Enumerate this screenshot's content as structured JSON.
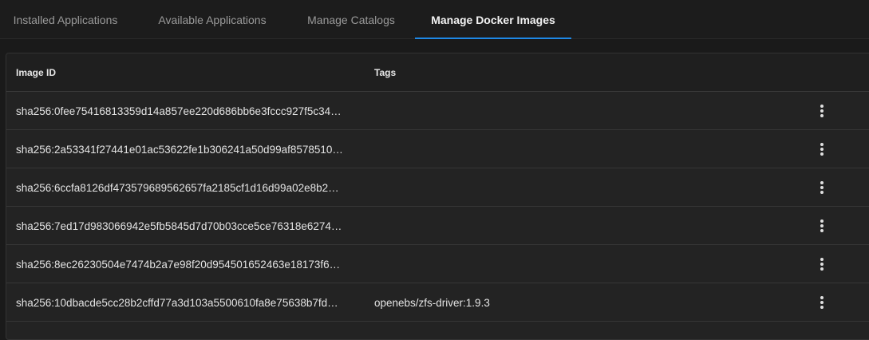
{
  "tabs": [
    {
      "label": "Installed Applications",
      "active": false
    },
    {
      "label": "Available Applications",
      "active": false
    },
    {
      "label": "Manage Catalogs",
      "active": false
    },
    {
      "label": "Manage Docker Images",
      "active": true
    }
  ],
  "accent_color": "#1e88e5",
  "table": {
    "columns": [
      "Image ID",
      "Tags"
    ],
    "rows": [
      {
        "image_id": "sha256:0fee75416813359d14a857ee220d686bb6e3fccc927f5c34…",
        "tags": ""
      },
      {
        "image_id": "sha256:2a53341f27441e01ac53622fe1b306241a50d99af8578510…",
        "tags": ""
      },
      {
        "image_id": "sha256:6ccfa8126df473579689562657fa2185cf1d16d99a02e8b2…",
        "tags": ""
      },
      {
        "image_id": "sha256:7ed17d983066942e5fb5845d7d70b03cce5ce76318e6274…",
        "tags": ""
      },
      {
        "image_id": "sha256:8ec26230504e7474b2a7e98f20d954501652463e18173f6…",
        "tags": ""
      },
      {
        "image_id": "sha256:10dbacde5cc28b2cffd77a3d103a5500610fa8e75638b7fd…",
        "tags": "openebs/zfs-driver:1.9.3"
      }
    ],
    "row_menu_icon": "more-vert-icon"
  }
}
